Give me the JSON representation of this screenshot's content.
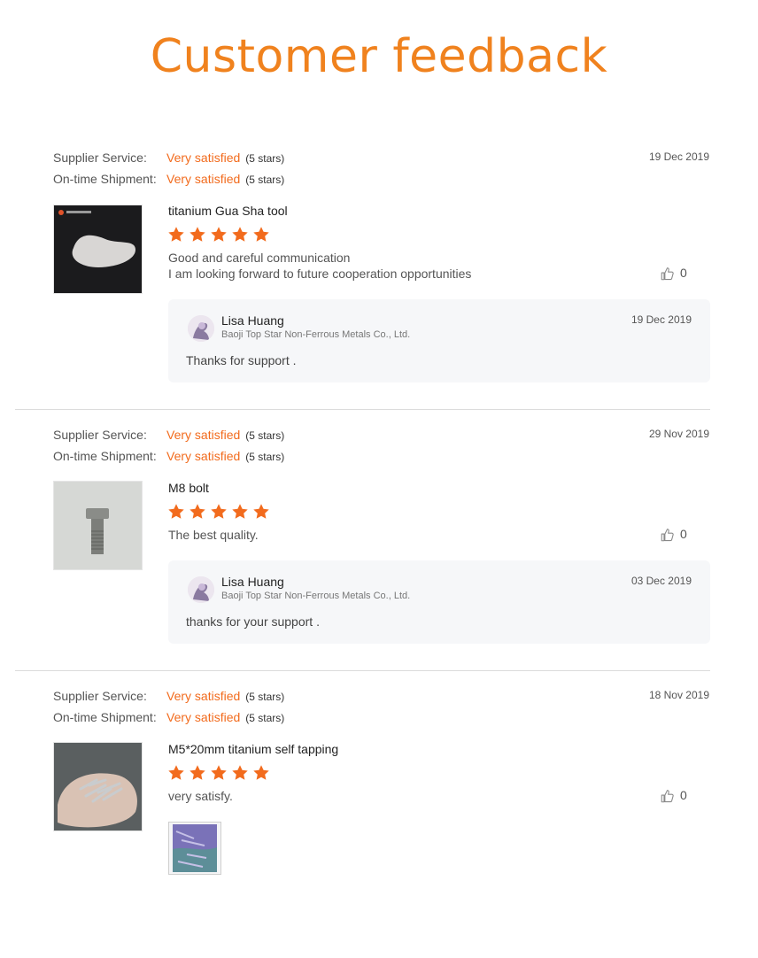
{
  "page_title": "Customer feedback",
  "labels": {
    "supplier_service": "Supplier Service:",
    "on_time_shipment": "On-time Shipment:"
  },
  "colors": {
    "accent": "#f26b1d",
    "title": "#f0821e",
    "reply_bg": "#f6f7f9"
  },
  "icons": {
    "star": "star-icon",
    "like": "thumbs-up-icon"
  },
  "reviews": [
    {
      "supplier_service": {
        "value": "Very satisfied",
        "stars_text": "(5 stars)"
      },
      "on_time_shipment": {
        "value": "Very satisfied",
        "stars_text": "(5 stars)"
      },
      "date": "19 Dec 2019",
      "product": "titanium Gua Sha tool",
      "rating": 5,
      "comment_lines": [
        "Good and careful communication",
        "I am looking forward to future cooperation opportunities"
      ],
      "likes": "0",
      "reply": {
        "name": "Lisa Huang",
        "company": "Baoji Top Star Non-Ferrous Metals Co., Ltd.",
        "date": "19 Dec 2019",
        "text": "Thanks for support ."
      }
    },
    {
      "supplier_service": {
        "value": "Very satisfied",
        "stars_text": "(5 stars)"
      },
      "on_time_shipment": {
        "value": "Very satisfied",
        "stars_text": "(5 stars)"
      },
      "date": "29 Nov 2019",
      "product": "M8 bolt",
      "rating": 5,
      "comment_lines": [
        "The best quality."
      ],
      "likes": "0",
      "reply": {
        "name": "Lisa Huang",
        "company": "Baoji Top Star Non-Ferrous Metals Co., Ltd.",
        "date": "03 Dec 2019",
        "text": "thanks for your support ."
      }
    },
    {
      "supplier_service": {
        "value": "Very satisfied",
        "stars_text": "(5 stars)"
      },
      "on_time_shipment": {
        "value": "Very satisfied",
        "stars_text": "(5 stars)"
      },
      "date": "18 Nov 2019",
      "product": "M5*20mm titanium self tapping",
      "rating": 5,
      "comment_lines": [
        "very satisfy."
      ],
      "likes": "0"
    }
  ]
}
